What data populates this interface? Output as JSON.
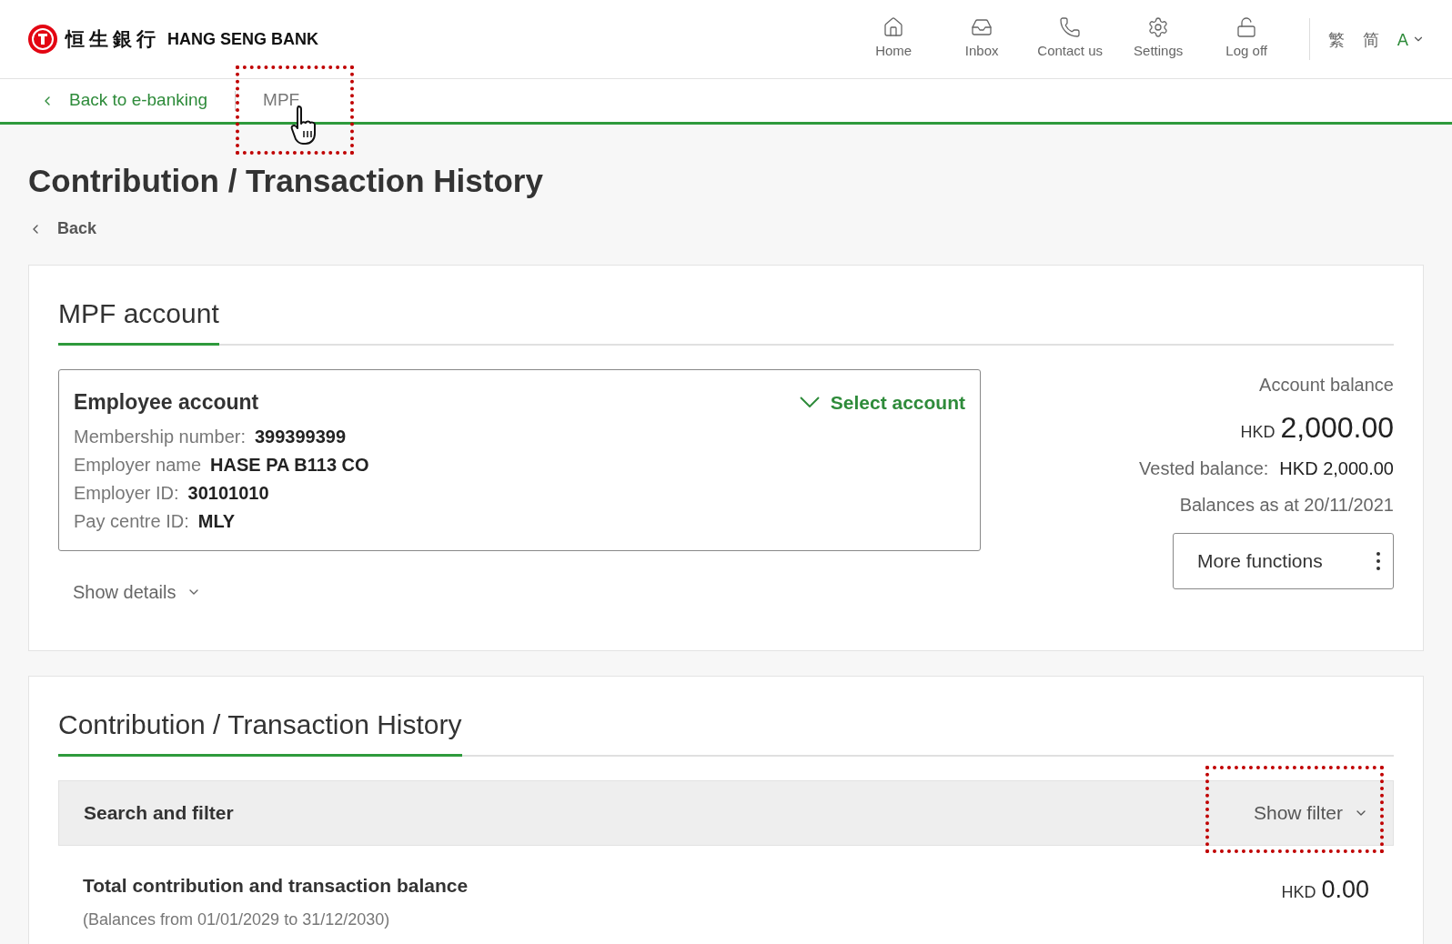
{
  "brand": {
    "chinese": "恒生銀行",
    "english": "HANG SENG BANK"
  },
  "nav": [
    {
      "label": "Home"
    },
    {
      "label": "Inbox"
    },
    {
      "label": "Contact us"
    },
    {
      "label": "Settings"
    },
    {
      "label": "Log off"
    }
  ],
  "languages": [
    {
      "label": "繁",
      "selected": false
    },
    {
      "label": "简",
      "selected": false
    },
    {
      "label": "A",
      "selected": true
    }
  ],
  "breadcrumb": {
    "back": "Back to e-banking",
    "current": "MPF"
  },
  "title": "Contribution / Transaction History",
  "back": "Back",
  "account_section": {
    "heading": "MPF account",
    "account": {
      "title": "Employee account",
      "select": "Select account",
      "fields": [
        {
          "label": "Membership number:",
          "value": "399399399"
        },
        {
          "label": "Employer name",
          "value": "HASE PA B113 CO"
        },
        {
          "label": "Employer ID:",
          "value": "30101010"
        },
        {
          "label": "Pay centre ID:",
          "value": "MLY"
        }
      ]
    },
    "show_details": "Show details",
    "balance_label": "Account balance",
    "currency": "HKD",
    "balance": "2,000.00",
    "vested_label": "Vested balance:",
    "vested_value": "HKD 2,000.00",
    "as_at": "Balances as at 20/11/2021",
    "more": "More functions"
  },
  "history_section": {
    "heading": "Contribution / Transaction History",
    "filter_title": "Search and filter",
    "show_filter": "Show filter",
    "total_label": "Total contribution and transaction balance",
    "total_range": "(Balances from 01/01/2029 to 31/12/2030)",
    "total_currency": "HKD",
    "total_value": "0.00"
  }
}
